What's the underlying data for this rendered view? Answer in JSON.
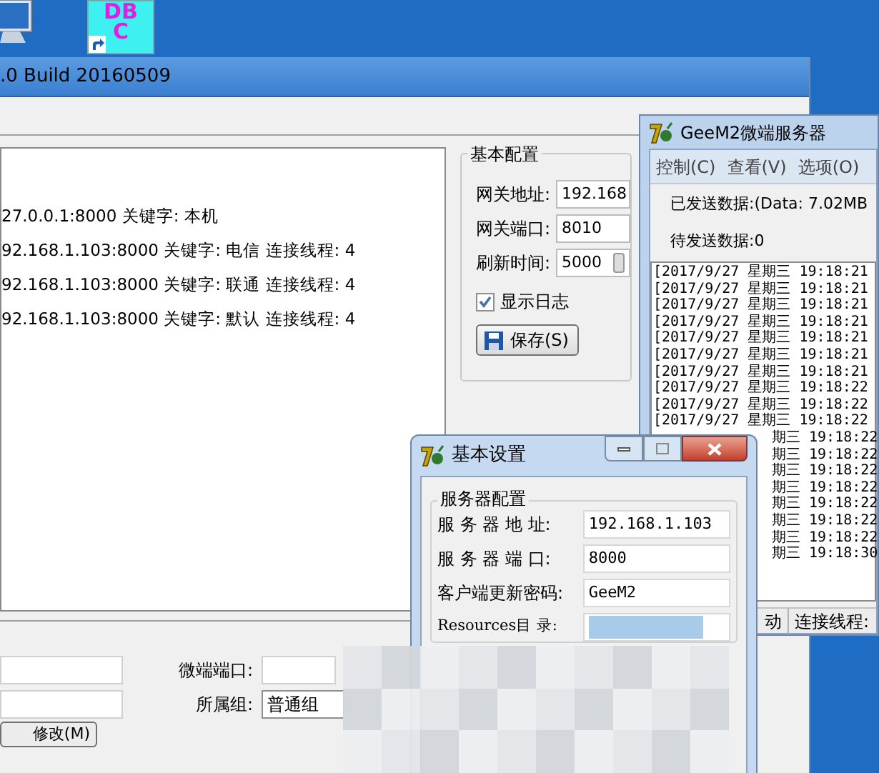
{
  "desktop_icon": {
    "text": "DBC"
  },
  "main_window": {
    "title": ".0 Build 20160509",
    "log_lines": [
      "27.0.0.1:8000 关键字: 本机",
      "92.168.1.103:8000 关键字: 电信 连接线程: 4",
      "92.168.1.103:8000 关键字: 联通 连接线程: 4",
      "92.168.1.103:8000 关键字: 默认 连接线程: 4"
    ],
    "config_group": {
      "title": "基本配置",
      "fields": [
        {
          "label": "网关地址:",
          "value": "192.168",
          "kind": "text"
        },
        {
          "label": "网关端口:",
          "value": "8010",
          "kind": "text"
        },
        {
          "label": "刷新时间:",
          "value": "5000",
          "kind": "spin"
        }
      ],
      "checkbox": {
        "label": "显示日志",
        "checked": true
      },
      "save_button": "保存(S)"
    },
    "bottom": {
      "port_label": "微端端口:",
      "group_label": "所属组:",
      "group_value": "普通组",
      "modify_button": "修改(M)"
    }
  },
  "server_window": {
    "title": "GeeM2微端服务器",
    "menu": [
      "控制(C)",
      "查看(V)",
      "选项(O)"
    ],
    "sent": "已发送数据:(Data: 7.02MB",
    "pending": "待发送数据:0",
    "log": [
      {
        "text": "[2017/9/27 星期三 19:18:21",
        "covered": false
      },
      {
        "text": "[2017/9/27 星期三 19:18:21",
        "covered": false
      },
      {
        "text": "[2017/9/27 星期三 19:18:21",
        "covered": false
      },
      {
        "text": "[2017/9/27 星期三 19:18:21",
        "covered": false
      },
      {
        "text": "[2017/9/27 星期三 19:18:21",
        "covered": false
      },
      {
        "text": "[2017/9/27 星期三 19:18:21",
        "covered": false
      },
      {
        "text": "[2017/9/27 星期三 19:18:21",
        "covered": false
      },
      {
        "text": "[2017/9/27 星期三 19:18:22",
        "covered": false
      },
      {
        "text": "[2017/9/27 星期三 19:18:22",
        "covered": false
      },
      {
        "text": "[2017/9/27 星期三 19:18:22",
        "covered": false
      },
      {
        "text": "期三 19:18:22",
        "covered": true
      },
      {
        "text": "期三 19:18:22",
        "covered": true
      },
      {
        "text": "期三 19:18:22",
        "covered": true
      },
      {
        "text": "期三 19:18:22",
        "covered": true
      },
      {
        "text": "期三 19:18:22",
        "covered": true
      },
      {
        "text": "期三 19:18:22",
        "covered": true
      },
      {
        "text": "期三 19:18:22",
        "covered": true
      },
      {
        "text": "期三 19:18:30",
        "covered": true
      }
    ],
    "status": [
      "动",
      "连接线程:"
    ]
  },
  "settings_window": {
    "title": "基本设置",
    "group_title": "服务器配置",
    "fields": [
      {
        "label": "服 务 器 地 址:",
        "value": "192.168.1.103",
        "blurred": false
      },
      {
        "label": "服 务 器 端 口:",
        "value": "8000",
        "blurred": false
      },
      {
        "label": "客户端更新密码:",
        "value": "GeeM2",
        "blurred": false
      },
      {
        "label": "Resources目 录:",
        "blurred": true
      }
    ]
  }
}
